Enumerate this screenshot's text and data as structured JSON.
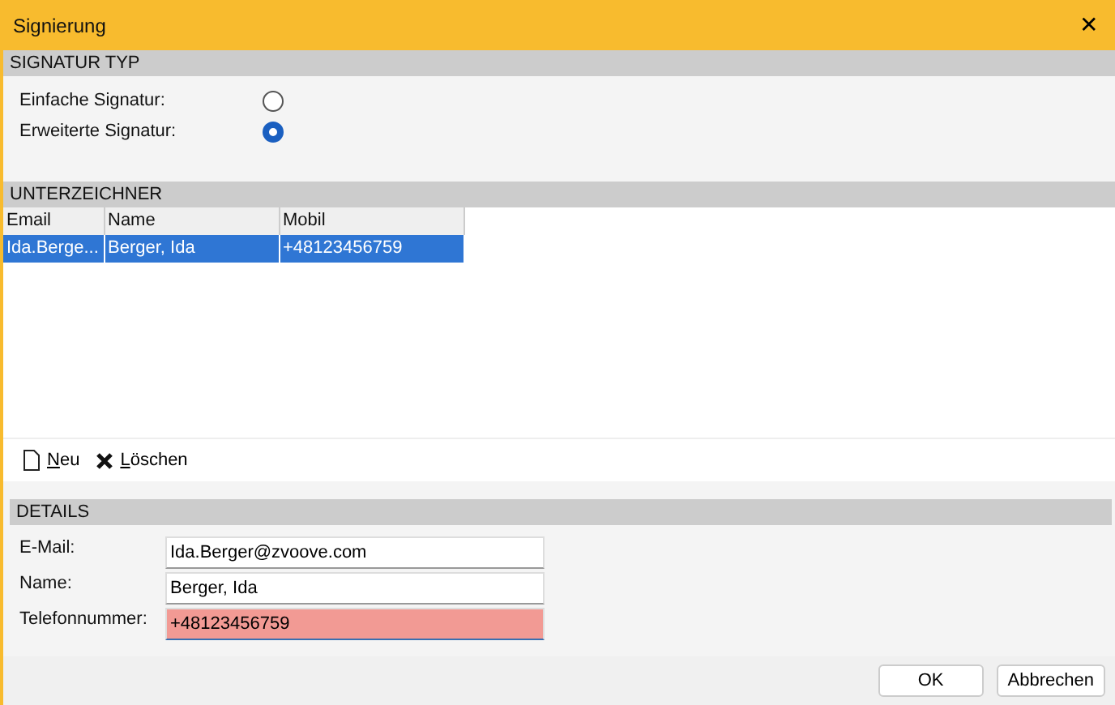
{
  "window": {
    "title": "Signierung",
    "close": "✕"
  },
  "signature_type": {
    "header": "SIGNATUR TYP",
    "options": [
      {
        "label": "Einfache Signatur:",
        "selected": false
      },
      {
        "label": "Erweiterte Signatur:",
        "selected": true
      }
    ]
  },
  "signers": {
    "header": "UNTERZEICHNER",
    "columns": [
      "Email",
      "Name",
      "Mobil"
    ],
    "rows": [
      {
        "cells": [
          "Ida.Berge...",
          "Berger, Ida",
          "+48123456759"
        ],
        "selected": true
      }
    ]
  },
  "toolbar": [
    {
      "label": "Neu",
      "kind": "new"
    },
    {
      "label": "Löschen",
      "kind": "delete"
    }
  ],
  "details": {
    "header": "DETAILS",
    "fields": [
      {
        "label": "E-Mail:",
        "value": "Ida.Berger@zvoove.com",
        "invalid": false
      },
      {
        "label": "Name:",
        "value": "Berger, Ida",
        "invalid": false
      },
      {
        "label": "Telefonnummer:",
        "value": "+48123456759",
        "invalid": true
      }
    ]
  },
  "buttons": [
    "OK",
    "Abbrechen"
  ]
}
